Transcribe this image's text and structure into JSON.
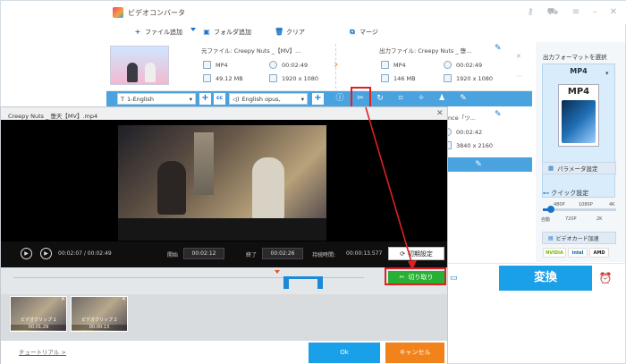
{
  "window": {
    "title": "ビデオコンバータ"
  },
  "toolbar": {
    "add_file": "ファイル追加",
    "add_folder": "フォルダ追加",
    "clear": "クリア",
    "merge": "マージ"
  },
  "file1": {
    "source_label": "元ファイル: Creepy Nuts _【MV】...",
    "format": "MP4",
    "duration": "00:02:49",
    "size": "49.12 MB",
    "resolution": "1920 x 1080",
    "output_label": "出力ファイル: Creepy Nuts _ 堕...",
    "out_format": "MP4",
    "out_duration": "00:02:49",
    "out_size": "146 MB",
    "out_resolution": "1920 x 1080"
  },
  "file2": {
    "output_label": "nce「ツ...",
    "out_duration": "00:02:42",
    "out_resolution": "3840 x 2160"
  },
  "edit_bar": {
    "subtitle": "1-English",
    "audio": "English opus,"
  },
  "right_panel": {
    "format_label": "出力フォーマットを選択",
    "format_name": "MP4",
    "param_settings": "パラメータ設定",
    "quick_settings": "クイック設定",
    "ticks_top": [
      "480P",
      "1080P",
      "4K"
    ],
    "ticks_bottom": [
      "自動",
      "720P",
      "2K"
    ],
    "gpu_accel": "ビデオカード加速",
    "gpu_badges": [
      "NVIDIA",
      "intel",
      "AMD"
    ]
  },
  "convert": {
    "label": "変換"
  },
  "dialog": {
    "title": "Creepy Nuts _ 堕天【MV】.mp4",
    "current_time": "00:02:07 / 00:02:49",
    "start_label": "開始",
    "start_time": "00:02:12",
    "end_label": "終了",
    "end_time": "00:02:26",
    "duration_label": "持続時間:",
    "duration_value": "00:00:13.577",
    "reset": "初期設定",
    "cut": "切り取り",
    "clips": [
      {
        "name": "ビデオクリップ 1",
        "time": "00:01:29"
      },
      {
        "name": "ビデオクリップ 2",
        "time": "00:00:13"
      }
    ],
    "tutorial": "チュートリアル >",
    "ok": "Ok",
    "cancel": "キャンセル"
  }
}
